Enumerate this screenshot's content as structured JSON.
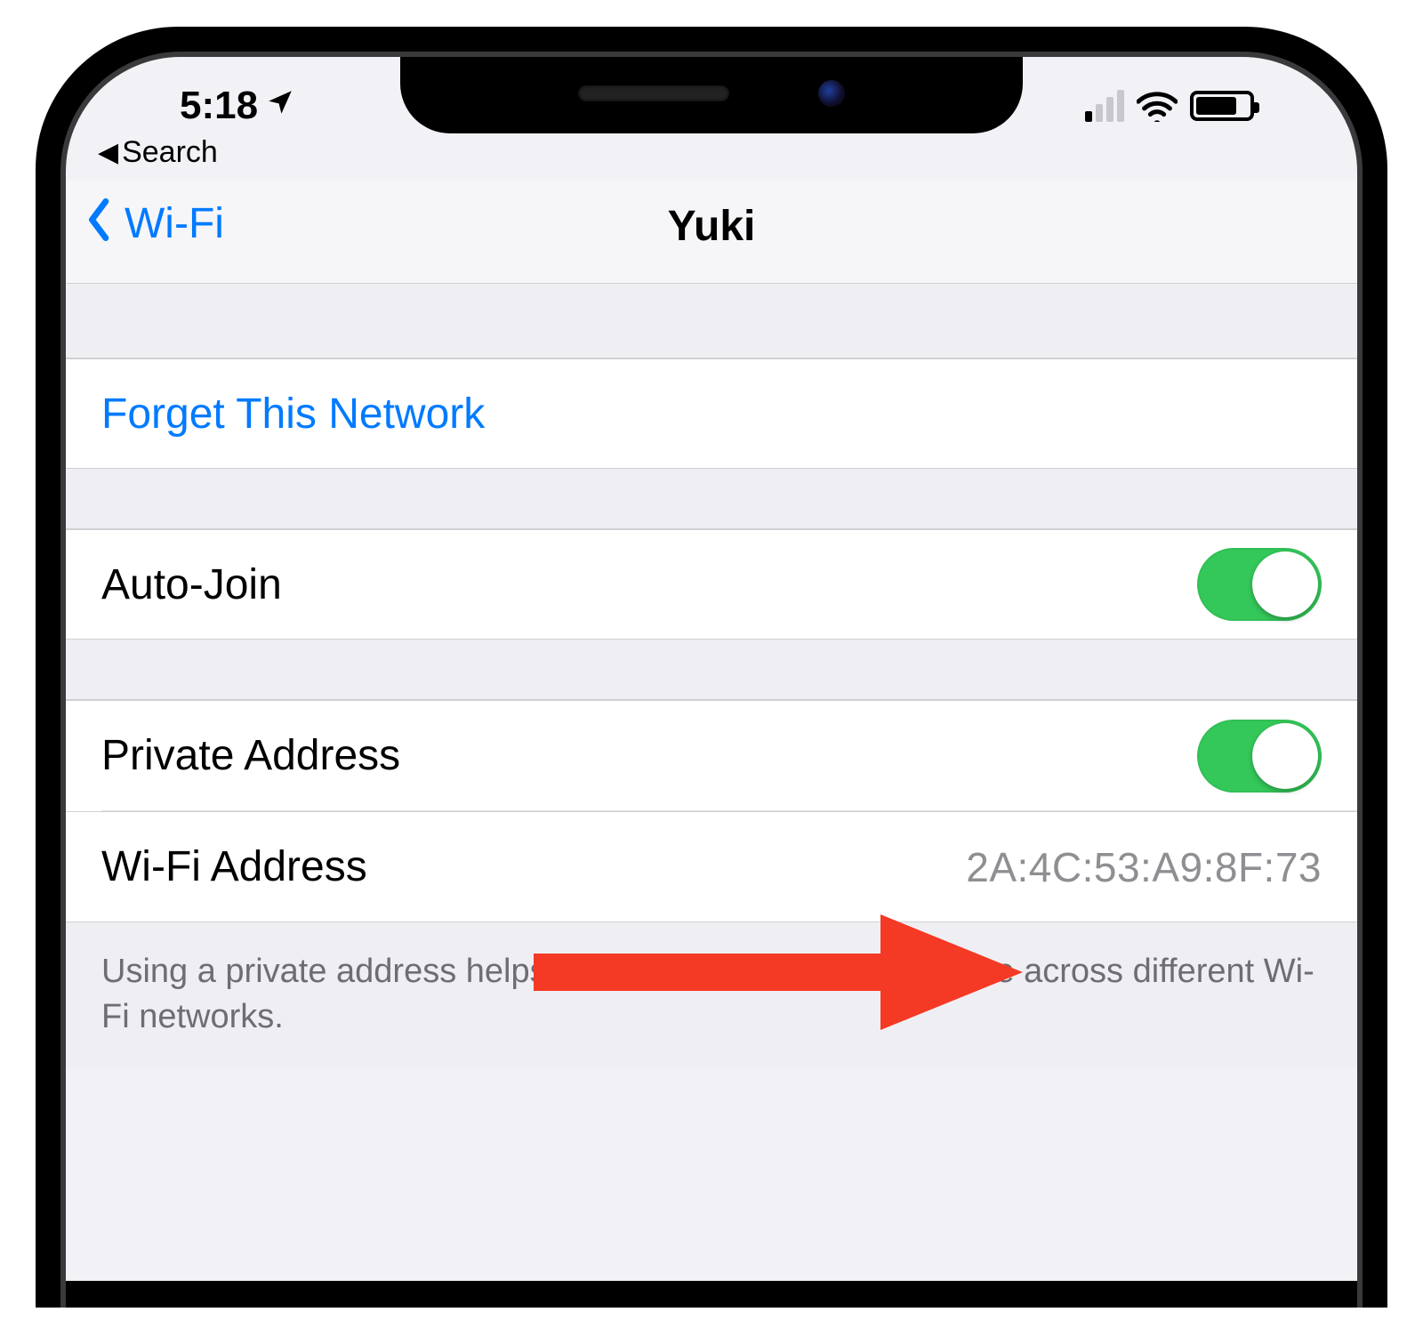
{
  "status": {
    "time": "5:18",
    "breadcrumb_back": "Search"
  },
  "nav": {
    "back_label": "Wi-Fi",
    "title": "Yuki"
  },
  "actions": {
    "forget": "Forget This Network"
  },
  "settings": {
    "auto_join": {
      "label": "Auto-Join",
      "on": true
    },
    "private_address": {
      "label": "Private Address",
      "on": true
    },
    "wifi_address": {
      "label": "Wi-Fi Address",
      "value": "2A:4C:53:A9:8F:73"
    }
  },
  "footer": {
    "text": "Using a private address helps reduce tracking of your iPhone across different Wi-Fi networks."
  },
  "colors": {
    "ios_blue": "#007aff",
    "toggle_green": "#34c759",
    "arrow_red": "#f43a24"
  }
}
